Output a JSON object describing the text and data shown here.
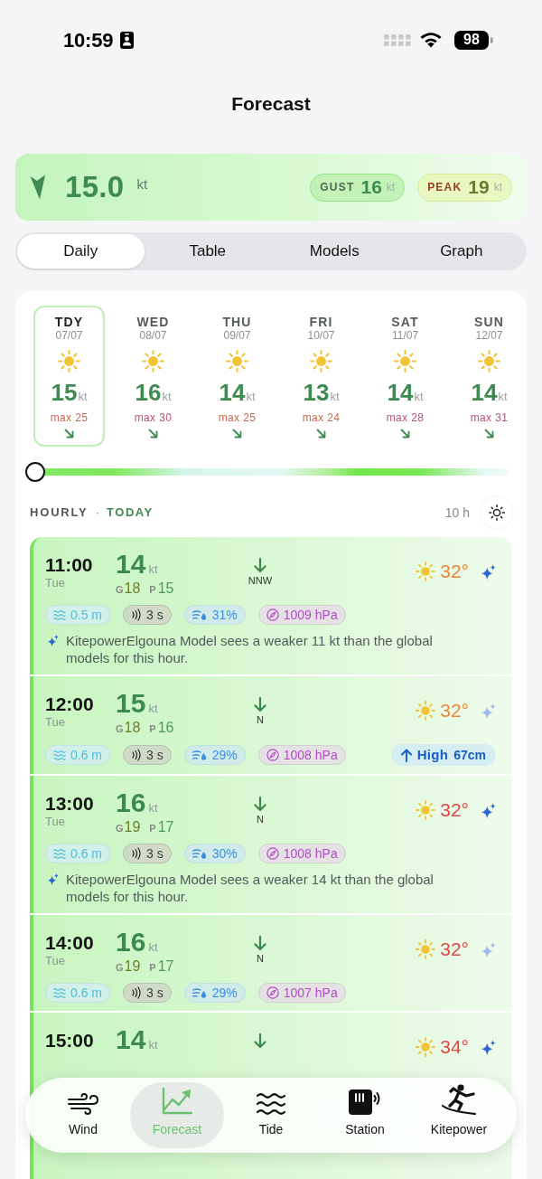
{
  "status_bar": {
    "time": "10:59",
    "battery": "98"
  },
  "header": {
    "title": "Forecast"
  },
  "current_wind": {
    "speed": "15.0",
    "unit": "kt",
    "gust": {
      "label": "GUST",
      "value": "16",
      "unit": "kt"
    },
    "peak": {
      "label": "PEAK",
      "value": "19",
      "unit": "kt"
    }
  },
  "tabs": [
    {
      "label": "Daily",
      "selected": true
    },
    {
      "label": "Table",
      "selected": false
    },
    {
      "label": "Models",
      "selected": false
    },
    {
      "label": "Graph",
      "selected": false
    }
  ],
  "days": [
    {
      "day": "TDY",
      "date": "07/07",
      "speed": "15",
      "unit": "kt",
      "max": {
        "text": "max 25",
        "color": "#c9674f"
      },
      "selected": true
    },
    {
      "day": "WED",
      "date": "08/07",
      "speed": "16",
      "unit": "kt",
      "max": {
        "text": "max 30",
        "color": "#b9507c"
      },
      "selected": false
    },
    {
      "day": "THU",
      "date": "09/07",
      "speed": "14",
      "unit": "kt",
      "max": {
        "text": "max 25",
        "color": "#c9674f"
      },
      "selected": false
    },
    {
      "day": "FRI",
      "date": "10/07",
      "speed": "13",
      "unit": "kt",
      "max": {
        "text": "max 24",
        "color": "#c9674f"
      },
      "selected": false
    },
    {
      "day": "SAT",
      "date": "11/07",
      "speed": "14",
      "unit": "kt",
      "max": {
        "text": "max 28",
        "color": "#b9507c"
      },
      "selected": false
    },
    {
      "day": "SUN",
      "date": "12/07",
      "speed": "14",
      "unit": "kt",
      "max": {
        "text": "max 31",
        "color": "#b9507c"
      },
      "selected": false
    }
  ],
  "timeline": {
    "level": 0
  },
  "hourly": {
    "title": "HOURLY",
    "separator": "·",
    "day": "TODAY",
    "range": "10 h",
    "rows": [
      {
        "time": "11:00",
        "day": "Tue",
        "speed": "14",
        "unit": "kt",
        "gust_label": "G",
        "gust": "18",
        "peak_label": "P",
        "peak": "15",
        "direction": "NNW",
        "temp": {
          "text": "32°",
          "color": "#e8893a"
        },
        "sparkle_active": true,
        "chips": [
          {
            "kind": "wave",
            "text": "0.5 m"
          },
          {
            "kind": "period",
            "text": "3 s"
          },
          {
            "kind": "humidity",
            "text": "31%"
          },
          {
            "kind": "pressure",
            "text": "1009 hPa"
          }
        ],
        "note": "KitepowerElgouna Model sees a weaker 11 kt than the global models for this hour."
      },
      {
        "time": "12:00",
        "day": "Tue",
        "speed": "15",
        "unit": "kt",
        "gust_label": "G",
        "gust": "18",
        "peak_label": "P",
        "peak": "16",
        "direction": "N",
        "temp": {
          "text": "32°",
          "color": "#e8893a"
        },
        "sparkle_active": false,
        "chips": [
          {
            "kind": "wave",
            "text": "0.6 m"
          },
          {
            "kind": "period",
            "text": "3 s"
          },
          {
            "kind": "humidity",
            "text": "29%"
          },
          {
            "kind": "pressure",
            "text": "1008 hPa"
          },
          {
            "kind": "tide",
            "label": "High",
            "text": "67cm"
          }
        ]
      },
      {
        "time": "13:00",
        "day": "Tue",
        "speed": "16",
        "unit": "kt",
        "gust_label": "G",
        "gust": "19",
        "peak_label": "P",
        "peak": "17",
        "direction": "N",
        "temp": {
          "text": "32°",
          "color": "#e04848"
        },
        "sparkle_active": true,
        "chips": [
          {
            "kind": "wave",
            "text": "0.6 m"
          },
          {
            "kind": "period",
            "text": "3 s"
          },
          {
            "kind": "humidity",
            "text": "30%"
          },
          {
            "kind": "pressure",
            "text": "1008 hPa"
          }
        ],
        "note": "KitepowerElgouna Model sees a weaker 14 kt than the global models for this hour."
      },
      {
        "time": "14:00",
        "day": "Tue",
        "speed": "16",
        "unit": "kt",
        "gust_label": "G",
        "gust": "19",
        "peak_label": "P",
        "peak": "17",
        "direction": "N",
        "temp": {
          "text": "32°",
          "color": "#e04848"
        },
        "sparkle_active": false,
        "chips": [
          {
            "kind": "wave",
            "text": "0.6 m"
          },
          {
            "kind": "period",
            "text": "3 s"
          },
          {
            "kind": "humidity",
            "text": "29%"
          },
          {
            "kind": "pressure",
            "text": "1007 hPa"
          }
        ]
      },
      {
        "time": "15:00",
        "speed": "14",
        "unit": "kt",
        "temp": {
          "text": "34°",
          "color": "#e04848"
        },
        "sparkle_active": true
      }
    ]
  },
  "nav": [
    {
      "label": "Wind",
      "selected": false
    },
    {
      "label": "Forecast",
      "selected": true
    },
    {
      "label": "Tide",
      "selected": false
    },
    {
      "label": "Station",
      "selected": false
    },
    {
      "label": "Kitepower",
      "selected": false
    }
  ]
}
